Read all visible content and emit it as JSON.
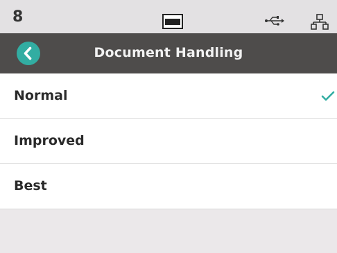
{
  "status_bar": {
    "count": "8",
    "icons": [
      "screen-icon",
      "usb-icon",
      "network-icon"
    ]
  },
  "header": {
    "title": "Document Handling",
    "back_icon": "chevron-left-icon"
  },
  "options": [
    {
      "label": "Normal",
      "selected": true
    },
    {
      "label": "Improved",
      "selected": false
    },
    {
      "label": "Best",
      "selected": false
    }
  ],
  "colors": {
    "accent": "#32ada2",
    "header_bg": "#4e4c4b",
    "status_bg": "#e3e1e3",
    "footer_bg": "#ebe8ea"
  }
}
